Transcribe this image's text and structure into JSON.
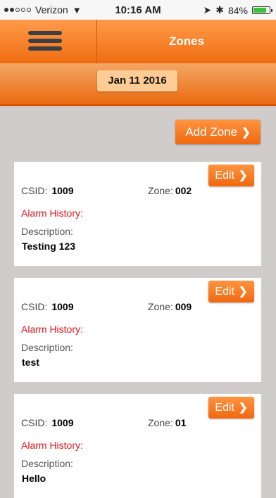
{
  "status_bar": {
    "carrier": "Verizon",
    "time": "10:16 AM",
    "battery": "84%",
    "battery_level": 0.84,
    "icons": [
      "signal-dots",
      "wifi-icon",
      "location-arrow-icon",
      "bluetooth-icon",
      "battery-icon"
    ]
  },
  "header": {
    "title": "Zones",
    "menu_icon": "hamburger-menu-icon"
  },
  "date": "Jan 11 2016",
  "add_zone_label": "Add Zone",
  "zones": [
    {
      "edit_label": "Edit",
      "csid_label": "CSID:",
      "csid": "1009",
      "zone_label": "Zone:",
      "zone": "002",
      "alarm_history_label": "Alarm History:",
      "description_label": "Description:",
      "description": "Testing 123"
    },
    {
      "edit_label": "Edit",
      "csid_label": "CSID:",
      "csid": "1009",
      "zone_label": "Zone:",
      "zone": "009",
      "alarm_history_label": "Alarm History:",
      "description_label": "Description:",
      "description": "test"
    },
    {
      "edit_label": "Edit",
      "csid_label": "CSID:",
      "csid": "1009",
      "zone_label": "Zone:",
      "zone": "01",
      "alarm_history_label": "Alarm History:",
      "description_label": "Description:",
      "description": "Hello"
    }
  ],
  "colors": {
    "accent": "#f07a1e",
    "alarm_text": "#e0141b",
    "background": "#cfcccb"
  }
}
